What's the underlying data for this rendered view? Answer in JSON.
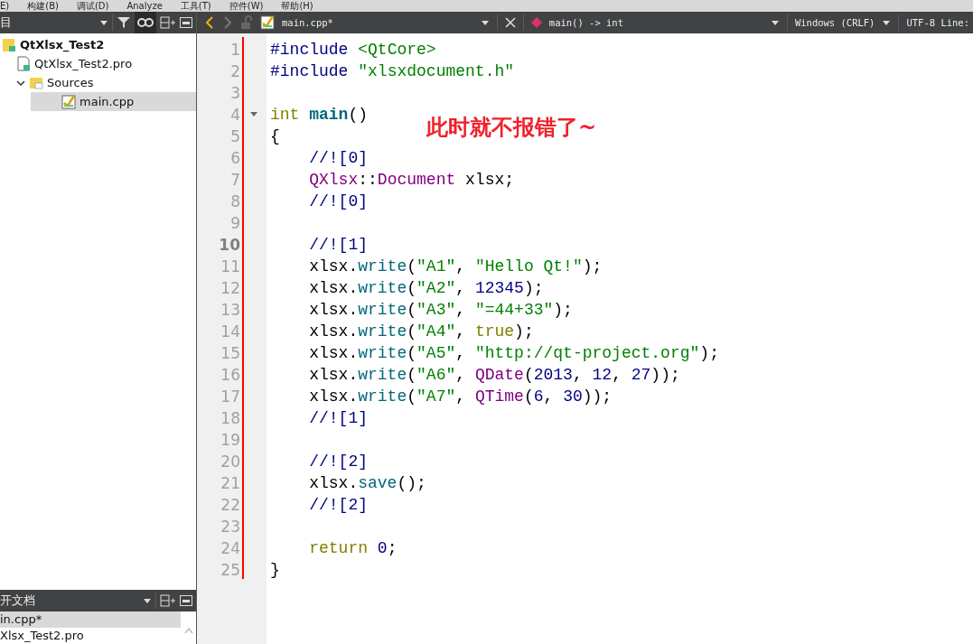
{
  "menu_bar": {
    "items": [
      "E)",
      "构建(B)",
      "调试(D)",
      "Analyze",
      "工具(T)",
      "控件(W)",
      "帮助(H)"
    ]
  },
  "sidebar": {
    "header": "目",
    "tree": [
      {
        "label": "QtXlsx_Test2",
        "kind": "project",
        "selected": false,
        "children": [
          {
            "label": "QtXlsx_Test2.pro",
            "kind": "profile",
            "selected": false
          },
          {
            "label": "Sources",
            "kind": "folder",
            "selected": false,
            "expanded": true,
            "children": [
              {
                "label": "main.cpp",
                "kind": "source",
                "selected": true
              }
            ]
          }
        ]
      }
    ]
  },
  "open_documents": {
    "title": "开文档",
    "items": [
      {
        "label": "in.cpp*",
        "selected": true
      },
      {
        "label": "Xlsx_Test2.pro",
        "selected": false
      }
    ]
  },
  "editor_toolbar": {
    "file": "main.cpp*",
    "symbol": "main() -> int",
    "line_endings": "Windows (CRLF)",
    "encoding": "UTF-8 Line:"
  },
  "editor": {
    "lines": [
      {
        "number": "1",
        "foldable": false,
        "tokens": [
          {
            "kind": "preproc",
            "text": "#include"
          },
          {
            "kind": "string",
            "text": " <QtCore>"
          }
        ]
      },
      {
        "number": "2",
        "foldable": false,
        "tokens": [
          {
            "kind": "preproc",
            "text": "#include"
          },
          {
            "kind": "string",
            "text": " \"xlsxdocument.h\""
          }
        ]
      },
      {
        "number": "3",
        "foldable": false
      },
      {
        "number": "4",
        "foldable": true,
        "tokens": [
          {
            "kind": "keyword",
            "text": "int"
          },
          {
            "kind": "funcdef",
            "text": " main"
          },
          {
            "kind": "plain",
            "text": "()"
          }
        ]
      },
      {
        "number": "5",
        "foldable": false,
        "tokens": [
          {
            "kind": "plain",
            "text": "{"
          }
        ]
      },
      {
        "number": "6",
        "foldable": false,
        "tokens": [
          {
            "kind": "comment",
            "text": "    //![0]"
          }
        ]
      },
      {
        "number": "7",
        "foldable": false,
        "tokens": [
          {
            "kind": "type",
            "text": "    QXlsx"
          },
          {
            "kind": "plain",
            "text": "::"
          },
          {
            "kind": "type",
            "text": "Document"
          },
          {
            "kind": "plain",
            "text": " xlsx;"
          }
        ]
      },
      {
        "number": "8",
        "foldable": false,
        "tokens": [
          {
            "kind": "comment",
            "text": "    //![0]"
          }
        ]
      },
      {
        "number": "9",
        "foldable": false
      },
      {
        "number": "10",
        "current": true,
        "foldable": false,
        "tokens": [
          {
            "kind": "comment",
            "text": "    //![1]"
          }
        ]
      },
      {
        "number": "11",
        "foldable": false,
        "tokens": [
          {
            "kind": "plain",
            "text": "    xlsx."
          },
          {
            "kind": "func",
            "text": "write"
          },
          {
            "kind": "plain",
            "text": "("
          },
          {
            "kind": "string",
            "text": "\"A1\""
          },
          {
            "kind": "plain",
            "text": ", "
          },
          {
            "kind": "string",
            "text": "\"Hello Qt!\""
          },
          {
            "kind": "plain",
            "text": ");"
          }
        ]
      },
      {
        "number": "12",
        "foldable": false,
        "tokens": [
          {
            "kind": "plain",
            "text": "    xlsx."
          },
          {
            "kind": "func",
            "text": "write"
          },
          {
            "kind": "plain",
            "text": "("
          },
          {
            "kind": "string",
            "text": "\"A2\""
          },
          {
            "kind": "plain",
            "text": ", "
          },
          {
            "kind": "number",
            "text": "12345"
          },
          {
            "kind": "plain",
            "text": ");"
          }
        ]
      },
      {
        "number": "13",
        "foldable": false,
        "tokens": [
          {
            "kind": "plain",
            "text": "    xlsx."
          },
          {
            "kind": "func",
            "text": "write"
          },
          {
            "kind": "plain",
            "text": "("
          },
          {
            "kind": "string",
            "text": "\"A3\""
          },
          {
            "kind": "plain",
            "text": ", "
          },
          {
            "kind": "string",
            "text": "\"=44+33\""
          },
          {
            "kind": "plain",
            "text": ");"
          }
        ]
      },
      {
        "number": "14",
        "foldable": false,
        "tokens": [
          {
            "kind": "plain",
            "text": "    xlsx."
          },
          {
            "kind": "func",
            "text": "write"
          },
          {
            "kind": "plain",
            "text": "("
          },
          {
            "kind": "string",
            "text": "\"A4\""
          },
          {
            "kind": "plain",
            "text": ", "
          },
          {
            "kind": "keyword",
            "text": "true"
          },
          {
            "kind": "plain",
            "text": ");"
          }
        ]
      },
      {
        "number": "15",
        "foldable": false,
        "tokens": [
          {
            "kind": "plain",
            "text": "    xlsx."
          },
          {
            "kind": "func",
            "text": "write"
          },
          {
            "kind": "plain",
            "text": "("
          },
          {
            "kind": "string",
            "text": "\"A5\""
          },
          {
            "kind": "plain",
            "text": ", "
          },
          {
            "kind": "string",
            "text": "\"http://qt-project.org\""
          },
          {
            "kind": "plain",
            "text": ");"
          }
        ]
      },
      {
        "number": "16",
        "foldable": false,
        "tokens": [
          {
            "kind": "plain",
            "text": "    xlsx."
          },
          {
            "kind": "func",
            "text": "write"
          },
          {
            "kind": "plain",
            "text": "("
          },
          {
            "kind": "string",
            "text": "\"A6\""
          },
          {
            "kind": "plain",
            "text": ", "
          },
          {
            "kind": "type",
            "text": "QDate"
          },
          {
            "kind": "plain",
            "text": "("
          },
          {
            "kind": "number",
            "text": "2013"
          },
          {
            "kind": "plain",
            "text": ", "
          },
          {
            "kind": "number",
            "text": "12"
          },
          {
            "kind": "plain",
            "text": ", "
          },
          {
            "kind": "number",
            "text": "27"
          },
          {
            "kind": "plain",
            "text": "));"
          }
        ]
      },
      {
        "number": "17",
        "foldable": false,
        "tokens": [
          {
            "kind": "plain",
            "text": "    xlsx."
          },
          {
            "kind": "func",
            "text": "write"
          },
          {
            "kind": "plain",
            "text": "("
          },
          {
            "kind": "string",
            "text": "\"A7\""
          },
          {
            "kind": "plain",
            "text": ", "
          },
          {
            "kind": "type",
            "text": "QTime"
          },
          {
            "kind": "plain",
            "text": "("
          },
          {
            "kind": "number",
            "text": "6"
          },
          {
            "kind": "plain",
            "text": ", "
          },
          {
            "kind": "number",
            "text": "30"
          },
          {
            "kind": "plain",
            "text": "));"
          }
        ]
      },
      {
        "number": "18",
        "foldable": false,
        "tokens": [
          {
            "kind": "comment",
            "text": "    //![1]"
          }
        ]
      },
      {
        "number": "19",
        "foldable": false
      },
      {
        "number": "20",
        "foldable": false,
        "tokens": [
          {
            "kind": "comment",
            "text": "    //![2]"
          }
        ]
      },
      {
        "number": "21",
        "foldable": false,
        "tokens": [
          {
            "kind": "plain",
            "text": "    xlsx."
          },
          {
            "kind": "func",
            "text": "save"
          },
          {
            "kind": "plain",
            "text": "();"
          }
        ]
      },
      {
        "number": "22",
        "foldable": false,
        "tokens": [
          {
            "kind": "comment",
            "text": "    //![2]"
          }
        ]
      },
      {
        "number": "23",
        "foldable": false
      },
      {
        "number": "24",
        "foldable": false,
        "tokens": [
          {
            "kind": "keyword",
            "text": "    return"
          },
          {
            "kind": "number",
            "text": " 0"
          },
          {
            "kind": "plain",
            "text": ";"
          }
        ]
      },
      {
        "number": "25",
        "foldable": false,
        "tokens": [
          {
            "kind": "plain",
            "text": "}"
          }
        ]
      }
    ]
  },
  "annotation": "此时就不报错了~"
}
